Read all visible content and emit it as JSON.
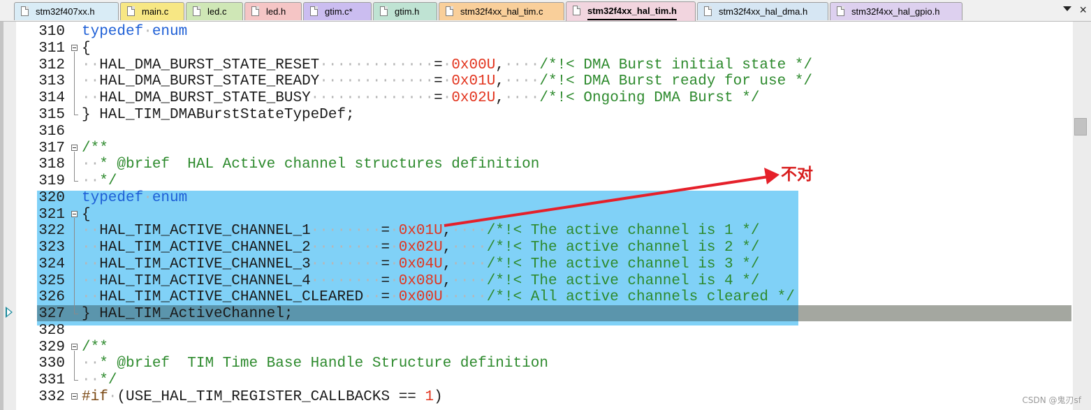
{
  "tabs": [
    {
      "label": "stm32f407xx.h",
      "color": "#d9ecf6"
    },
    {
      "label": "main.c",
      "color": "#f7e784"
    },
    {
      "label": "led.c",
      "color": "#cfe7b6"
    },
    {
      "label": "led.h",
      "color": "#f5c5c5"
    },
    {
      "label": "gtim.c*",
      "color": "#cbbdf0"
    },
    {
      "label": "gtim.h",
      "color": "#bfe3d3"
    },
    {
      "label": "stm32f4xx_hal_tim.c",
      "color": "#f9cf9a"
    },
    {
      "label": "stm32f4xx_hal_tim.h",
      "color": "#f2d5df",
      "active": true
    },
    {
      "label": "stm32f4xx_hal_dma.h",
      "color": "#d6e6f3"
    },
    {
      "label": "stm32f4xx_hal_gpio.h",
      "color": "#ddd0ef"
    }
  ],
  "editor": {
    "line_numbers": [
      "310",
      "311",
      "312",
      "313",
      "314",
      "315",
      "316",
      "317",
      "318",
      "319",
      "320",
      "321",
      "322",
      "323",
      "324",
      "325",
      "326",
      "327",
      "328",
      "329",
      "330",
      "331",
      "332"
    ],
    "current_line": "327",
    "selection_lines": [
      "320",
      "327"
    ]
  },
  "code": {
    "l310": {
      "kw": "typedef",
      "kw2": "enum"
    },
    "l311": {
      "t": "{"
    },
    "l312": {
      "name": "HAL_DMA_BURST_STATE_RESET",
      "eq": "=",
      "val": "0x00U",
      "comma": ",",
      "cm": "/*!< DMA Burst initial state */"
    },
    "l313": {
      "name": "HAL_DMA_BURST_STATE_READY",
      "eq": "=",
      "val": "0x01U",
      "comma": ",",
      "cm": "/*!< DMA Burst ready for use */"
    },
    "l314": {
      "name": "HAL_DMA_BURST_STATE_BUSY",
      "eq": "=",
      "val": "0x02U",
      "comma": ",",
      "cm": "/*!< Ongoing DMA Burst */"
    },
    "l315": {
      "t": "} HAL_TIM_DMABurstStateTypeDef;"
    },
    "l317": {
      "cm": "/**"
    },
    "l318": {
      "cm": "* @brief  HAL Active channel structures definition"
    },
    "l319": {
      "cm": "*/"
    },
    "l320": {
      "kw": "typedef",
      "kw2": "enum"
    },
    "l321": {
      "t": "{"
    },
    "l322": {
      "name": "HAL_TIM_ACTIVE_CHANNEL_1",
      "eq": "=",
      "val": "0x01U",
      "comma": ",",
      "cm": "/*!< The active channel is 1 */"
    },
    "l323": {
      "name": "HAL_TIM_ACTIVE_CHANNEL_2",
      "eq": "=",
      "val": "0x02U",
      "comma": ",",
      "cm": "/*!< The active channel is 2 */"
    },
    "l324": {
      "name": "HAL_TIM_ACTIVE_CHANNEL_3",
      "eq": "=",
      "val": "0x04U",
      "comma": ",",
      "cm": "/*!< The active channel is 3 */"
    },
    "l325": {
      "name": "HAL_TIM_ACTIVE_CHANNEL_4",
      "eq": "=",
      "val": "0x08U",
      "comma": ",",
      "cm": "/*!< The active channel is 4 */"
    },
    "l326": {
      "name": "HAL_TIM_ACTIVE_CHANNEL_CLEARED",
      "eq": "=",
      "val": "0x00U",
      "cm": "/*!< All active channels cleared */"
    },
    "l327": {
      "t": "} HAL_TIM_ActiveChannel;"
    },
    "l329": {
      "cm": "/**"
    },
    "l330": {
      "cm": "* @brief  TIM Time Base Handle Structure definition"
    },
    "l331": {
      "cm": "*/"
    },
    "l332": {
      "pp": "#if",
      "t": "(USE_HAL_TIM_REGISTER_CALLBACKS == ",
      "val": "1",
      "t2": ")"
    }
  },
  "annotation": {
    "text": "不对",
    "color": "#e01e1e"
  },
  "watermark": "CSDN @鬼刃sf"
}
